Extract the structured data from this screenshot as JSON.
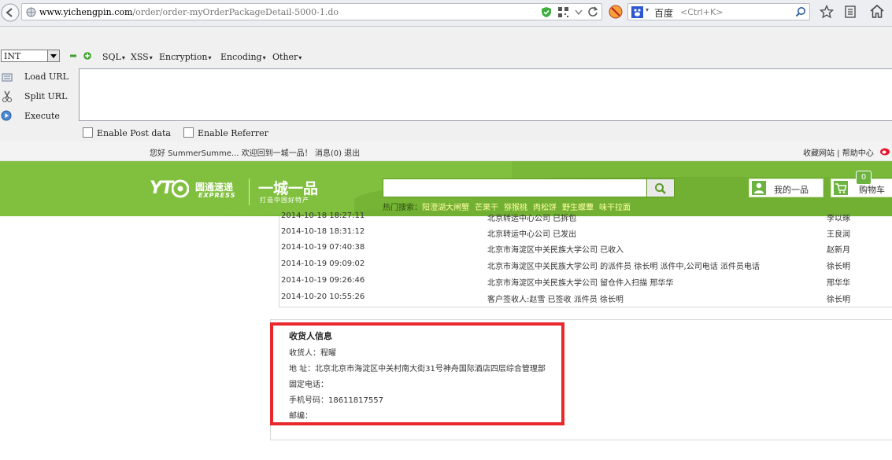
{
  "browser": {
    "url_domain": "www.yichengpin.com",
    "url_path": "/order/order-myOrderPackageDetail-5000-1.do",
    "search_engine": "百度",
    "search_placeholder": "<Ctrl+K>"
  },
  "hackbar": {
    "type_select": "INT",
    "menus": [
      "SQL",
      "XSS",
      "Encryption",
      "Encoding",
      "Other"
    ],
    "buttons": [
      "Load URL",
      "Split URL",
      "Execute"
    ],
    "checkboxes": [
      "Enable Post data",
      "Enable Referrer"
    ]
  },
  "site_top": {
    "greeting": "您好  SummerSumme... 欢迎回到一城一品！ 消息(0) 退出",
    "links": "收藏网站 | 帮助中心"
  },
  "header": {
    "logo_text": "YT",
    "courier_name_cn": "圆通速递",
    "courier_name_en": "EXPRESS",
    "brand_name": "一城一品",
    "brand_slogan": "打造中国好特产",
    "hot_label": "热门搜索：",
    "hot_keywords": [
      "阳澄湖大闸蟹",
      "芒果干",
      "猕猴桃",
      "肉松饼",
      "野生蝶蕈",
      "味干拉面"
    ],
    "my_account": "我的一品",
    "cart_label": "购物车",
    "cart_count": "0"
  },
  "tracking": {
    "rows": [
      {
        "time": "2014-10-18 18:27:11",
        "event": "北京转运中心公司 已拆包",
        "person": "李以琢"
      },
      {
        "time": "2014-10-18 18:31:12",
        "event": "北京转运中心公司 已发出",
        "person": "王良润"
      },
      {
        "time": "2014-10-19 07:40:38",
        "event": "北京市海淀区中关民族大学公司 已收入",
        "person": "赵新月"
      },
      {
        "time": "2014-10-19 09:09:02",
        "event": "北京市海淀区中关民族大学公司 的派件员 徐长明 派件中,公司电话 派件员电话",
        "person": "徐长明"
      },
      {
        "time": "2014-10-19 09:26:46",
        "event": "北京市海淀区中关民族大学公司 留仓件入扫描 邢华华",
        "person": "邢华华"
      },
      {
        "time": "2014-10-20 10:55:26",
        "event": "客户签收人:赵雪 已签收 派件员 徐长明",
        "person": "徐长明"
      }
    ]
  },
  "receiver": {
    "title": "收货人信息",
    "name": "收货人：程曜",
    "address": "地 址：北京北京市海淀区中关村南大街31号神舟国际酒店四层综合管理部",
    "landline": "固定电话：",
    "mobile": "手机号码：18611817557",
    "postcode": "邮编："
  },
  "colors": {
    "header_green": "#7ab83a",
    "highlight_red": "#e8282c"
  }
}
